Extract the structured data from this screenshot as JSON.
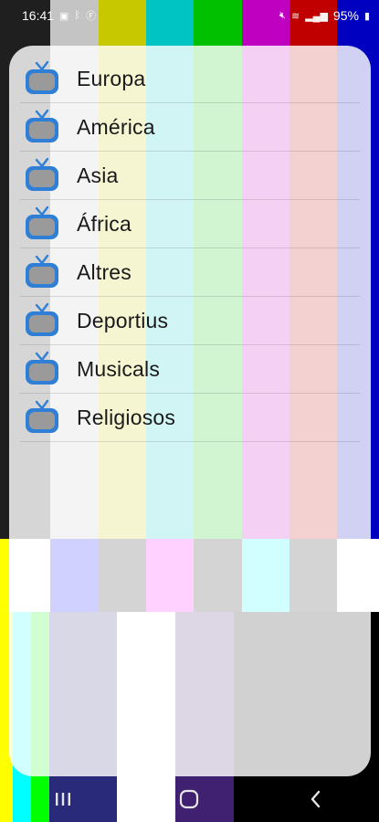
{
  "status_bar": {
    "time": "16:41",
    "battery": "95%",
    "left_icons": [
      "image-icon",
      "bluetooth-icon",
      "f-app-icon"
    ],
    "right_icons": [
      "mute-icon",
      "wifi-icon",
      "signal-icon",
      "battery-icon"
    ]
  },
  "menu": {
    "items": [
      {
        "label": "Europa",
        "icon": "tv-icon"
      },
      {
        "label": "América",
        "icon": "tv-icon"
      },
      {
        "label": "Asia",
        "icon": "tv-icon"
      },
      {
        "label": "África",
        "icon": "tv-icon"
      },
      {
        "label": "Altres",
        "icon": "tv-icon"
      },
      {
        "label": "Deportius",
        "icon": "tv-icon"
      },
      {
        "label": "Musicals",
        "icon": "tv-icon"
      },
      {
        "label": "Religiosos",
        "icon": "tv-icon"
      }
    ]
  },
  "navigation": {
    "recent_icon": "recent-apps-icon",
    "home_icon": "home-icon",
    "back_icon": "back-icon"
  },
  "colors": {
    "background_bars_top": [
      "#1f1f1f",
      "#c4c4c4",
      "#c8c800",
      "#00c3c3",
      "#00c000",
      "#c000c0",
      "#c00000",
      "#0000c0"
    ],
    "background_bars_mid": [
      "#ffffff",
      "#00ffff",
      "#0000ff",
      "#000000",
      "#ff00ff",
      "#000000",
      "#00ffff",
      "#000000",
      "#ffffff",
      "#000000"
    ],
    "background_bars_bottom": [
      "#ffff00",
      "#00ffff",
      "#00ff00",
      "#ff00ff",
      "#ff0000",
      "#0000ff",
      "#ffffff",
      "#402070",
      "#000000",
      "#000000"
    ],
    "tv_icon": "#2f7fd6",
    "tv_screen": "#9a9a9a"
  }
}
